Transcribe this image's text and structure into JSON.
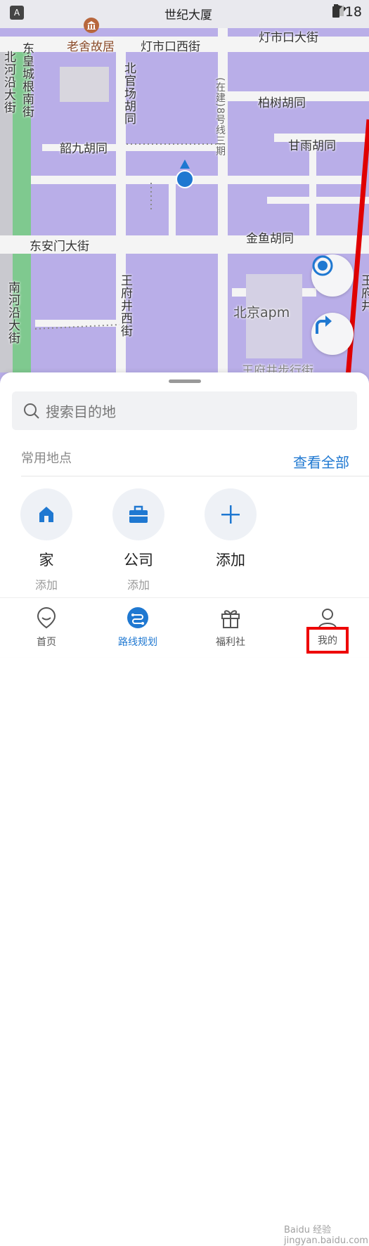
{
  "status_bar": {
    "title": "世纪大厦",
    "time": "4:18",
    "left_badge": "A"
  },
  "map": {
    "labels": {
      "poi_lao_she": "老舍故居",
      "dengshikou_west": "灯市口西街",
      "dengshikou_east": "灯市口大街",
      "donghuangcheng": "东皇城根南街",
      "bei_he_yan": "北河沿大街",
      "beiguanchang": "北官场胡同",
      "under_construction": "(在建)8号线三期",
      "baishu": "柏树胡同",
      "shaojiu": "韶九胡同",
      "ganyu": "甘雨胡同",
      "dong_an_men": "东安门大街",
      "jinyu": "金鱼胡同",
      "wangfujing_west": "王府井西街",
      "nan_he_yan": "南河沿大街",
      "beijing_apm": "北京apm",
      "wangfujing_walk": "王府井步行街",
      "edge_right": "王府井"
    }
  },
  "fab": {
    "locate_icon": "locate-target-icon",
    "route_icon": "turn-arrow-icon"
  },
  "search": {
    "placeholder": "搜索目的地",
    "icon": "search-icon"
  },
  "common_places": {
    "title": "常用地点",
    "view_all": "查看全部",
    "items": [
      {
        "name": "家",
        "sub": "添加",
        "icon": "home-icon"
      },
      {
        "name": "公司",
        "sub": "添加",
        "icon": "briefcase-icon"
      },
      {
        "name": "添加",
        "sub": "",
        "icon": "plus-icon"
      }
    ]
  },
  "tabs": [
    {
      "label": "首页",
      "icon": "home-heart-icon"
    },
    {
      "label": "路线规划",
      "icon": "route-icon"
    },
    {
      "label": "福利社",
      "icon": "gift-icon"
    },
    {
      "label": "我的",
      "icon": "user-icon"
    }
  ],
  "watermark": "Baidu 经验 jingyan.baidu.com",
  "colors": {
    "accent": "#1f78d1",
    "map_block": "#b9aee8",
    "highlight": "#e00000"
  }
}
